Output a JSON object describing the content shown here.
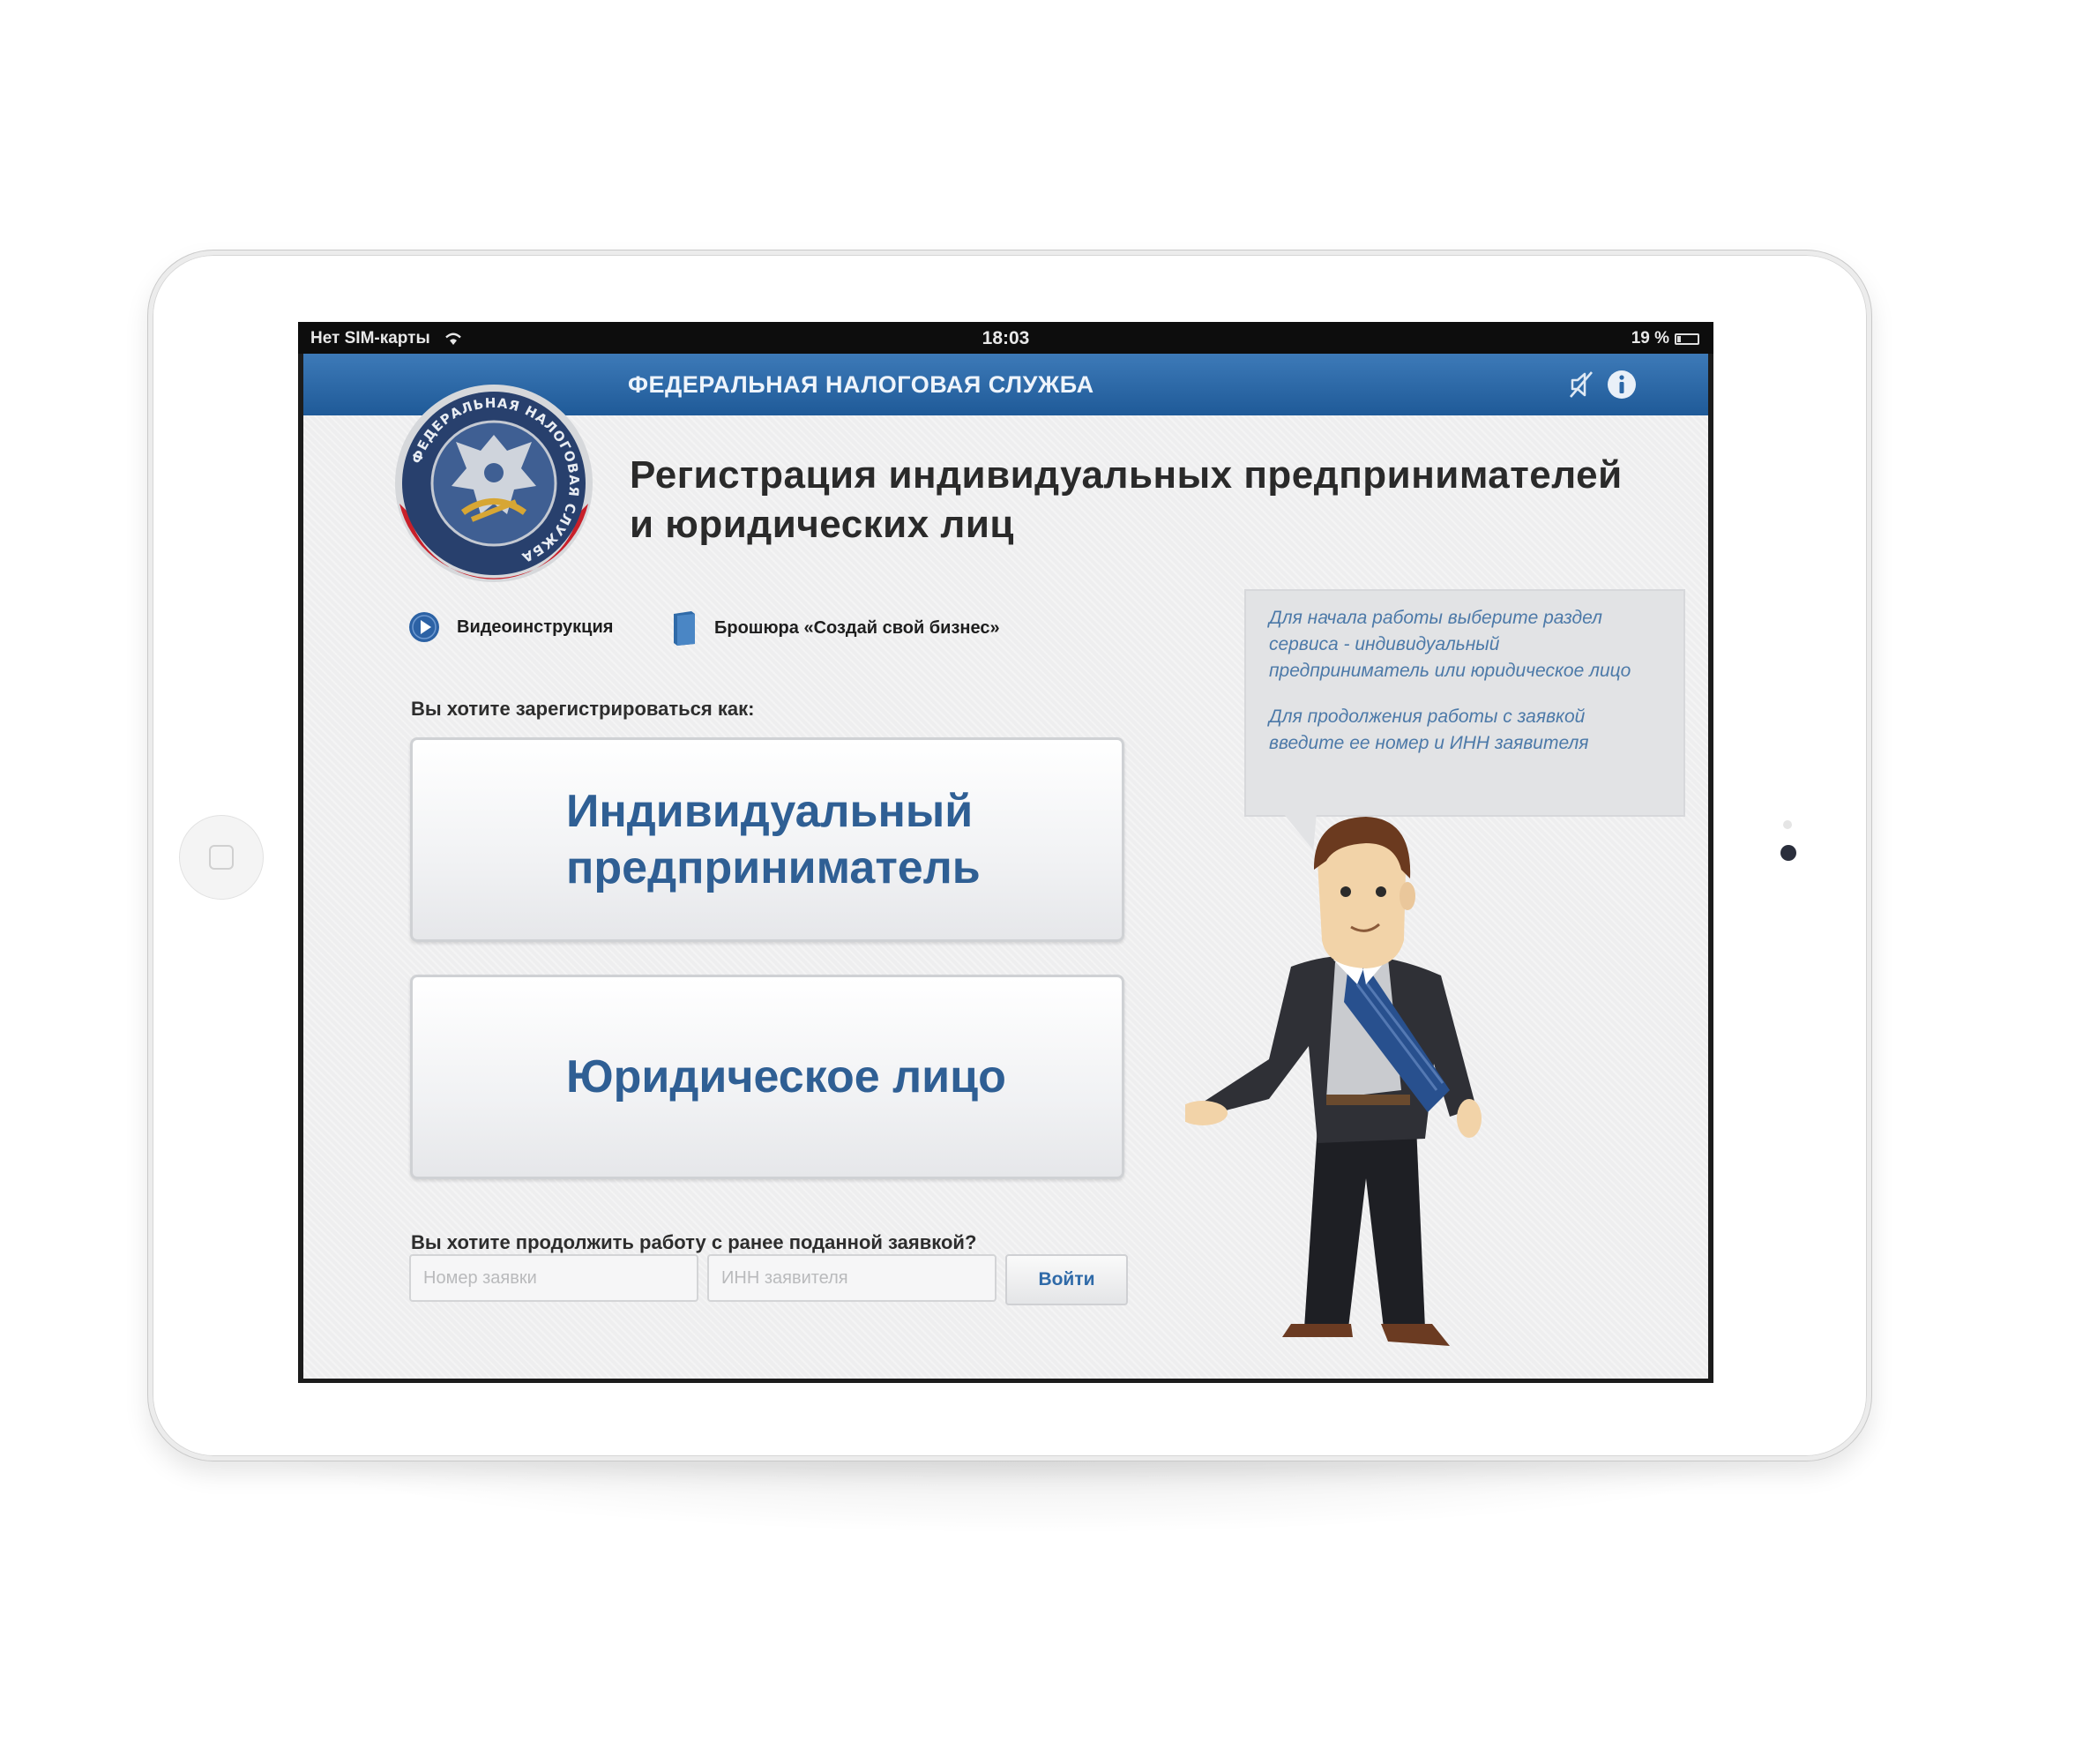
{
  "status_bar": {
    "carrier": "Нет SIM-карты",
    "time": "18:03",
    "battery": "19 %",
    "battery_level": 0.19
  },
  "navbar": {
    "title": "ФЕДЕРАЛЬНАЯ НАЛОГОВАЯ СЛУЖБА",
    "icons": [
      "mute-icon",
      "info-icon"
    ]
  },
  "emblem": {
    "text": "ФЕДЕРАЛЬНАЯ НАЛОГОВАЯ СЛУЖБА"
  },
  "page": {
    "heading_line1": "Регистрация индивидуальных предпринимателей",
    "heading_line2": "и юридических лиц",
    "links": {
      "video": "Видеоинструкция",
      "brochure": "Брошюра «Создай свой бизнес»"
    },
    "register_prompt": "Вы хотите зарегистрироваться как:",
    "options": {
      "individual": "Индивидуальный\nпредприниматель",
      "legal": "Юридическое лицо"
    },
    "continue_prompt": "Вы хотите продолжить работу с ранее поданной заявкой?",
    "application_placeholder": "Номер заявки",
    "inn_placeholder": "ИНН заявителя",
    "login_label": "Войти"
  },
  "hint": {
    "paragraph1": "Для начала работы выберите раздел сервиса - индивидуальный предприниматель или юридическое лицо",
    "paragraph2": "Для продолжения работы с заявкой введите ее номер и ИНН заявителя"
  },
  "colors": {
    "nav_blue": "#2b67a6",
    "button_text": "#2f5f94",
    "hint_text": "#4c79a8"
  }
}
